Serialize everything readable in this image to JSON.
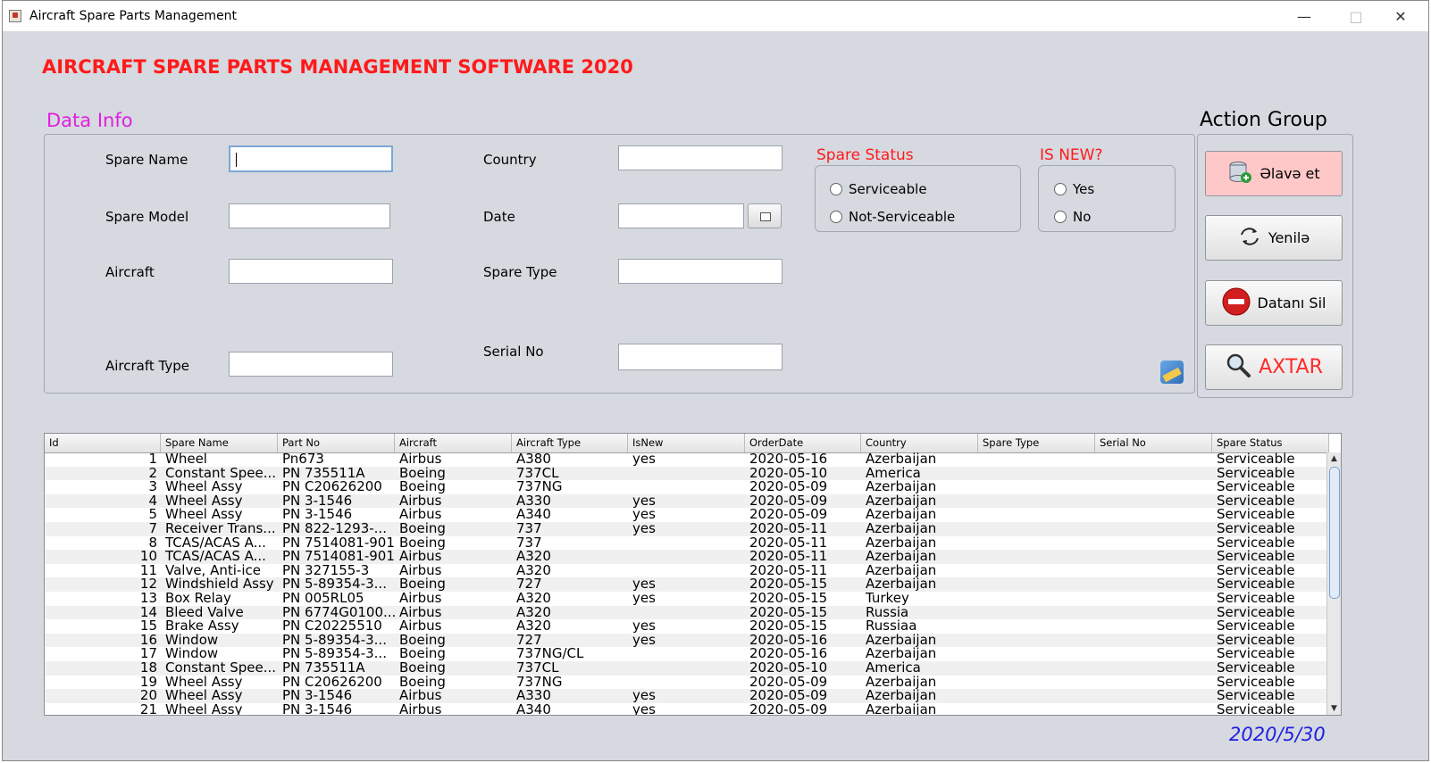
{
  "window": {
    "title": "Aircraft Spare Parts Management"
  },
  "heading": "AIRCRAFT SPARE PARTS MANAGEMENT SOFTWARE 2020",
  "data_info": {
    "label": "Data Info",
    "spare_name_label": "Spare Name",
    "spare_model_label": "Spare Model",
    "aircraft_label": "Aircraft",
    "aircraft_type_label": "Aircraft Type",
    "country_label": "Country",
    "date_label": "Date",
    "spare_type_label": "Spare Type",
    "serial_no_label": "Serial No",
    "spare_status_title": "Spare Status",
    "serviceable_label": "Serviceable",
    "not_serviceable_label": "Not-Serviceable",
    "is_new_title": "IS NEW?",
    "yes_label": "Yes",
    "no_label": "No"
  },
  "actions": {
    "title": "Action Group",
    "add_label": "Əlavə et",
    "refresh_label": "Yenilə",
    "delete_label": "Datanı Sil",
    "search_label": "AXTAR"
  },
  "table": {
    "columns": [
      "Id",
      "Spare Name",
      "Part No",
      "Aircraft",
      "Aircraft Type",
      "IsNew",
      "OrderDate",
      "Country",
      "Spare Type",
      "Serial No",
      "Spare Status"
    ],
    "rows": [
      [
        "1",
        "Wheel",
        "Pn673",
        "Airbus",
        "A380",
        "yes",
        "2020-05-16",
        "Azerbaijan",
        "",
        "",
        "Serviceable"
      ],
      [
        "2",
        "Constant Spee...",
        "PN 735511A",
        "Boeing",
        "737CL",
        "",
        "2020-05-10",
        "America",
        "",
        "",
        "Serviceable"
      ],
      [
        "3",
        "Wheel Assy",
        "PN C20626200",
        "Boeing",
        "737NG",
        "",
        "2020-05-09",
        "Azerbaijan",
        "",
        "",
        "Serviceable"
      ],
      [
        "4",
        "Wheel Assy",
        "PN 3-1546",
        "Airbus",
        "A330",
        "yes",
        "2020-05-09",
        "Azerbaijan",
        "",
        "",
        "Serviceable"
      ],
      [
        "5",
        "Wheel Assy",
        "PN 3-1546",
        "Airbus",
        "A340",
        "yes",
        "2020-05-09",
        "Azerbaijan",
        "",
        "",
        "Serviceable"
      ],
      [
        "7",
        "Receiver Trans...",
        "PN 822-1293-...",
        "Boeing",
        "737",
        "yes",
        "2020-05-11",
        "Azerbaijan",
        "",
        "",
        "Serviceable"
      ],
      [
        "8",
        "TCAS/ACAS A...",
        "PN 7514081-901",
        "Boeing",
        "737",
        "",
        "2020-05-11",
        "Azerbaijan",
        "",
        "",
        "Serviceable"
      ],
      [
        "10",
        "TCAS/ACAS A...",
        "PN 7514081-901",
        "Airbus",
        "A320",
        "",
        "2020-05-11",
        "Azerbaijan",
        "",
        "",
        "Serviceable"
      ],
      [
        "11",
        "Valve, Anti-ice",
        "PN 327155-3",
        "Airbus",
        "A320",
        "",
        "2020-05-11",
        "Azerbaijan",
        "",
        "",
        "Serviceable"
      ],
      [
        "12",
        "Windshield Assy",
        "PN 5-89354-3...",
        "Boeing",
        "727",
        "yes",
        "2020-05-15",
        "Azerbaijan",
        "",
        "",
        "Serviceable"
      ],
      [
        "13",
        "Box Relay",
        "PN 005RL05",
        "Airbus",
        "A320",
        "yes",
        "2020-05-15",
        "Turkey",
        "",
        "",
        "Serviceable"
      ],
      [
        "14",
        "Bleed Valve",
        "PN 6774G0100...",
        "Airbus",
        "A320",
        "",
        "2020-05-15",
        "Russia",
        "",
        "",
        "Serviceable"
      ],
      [
        "15",
        "Brake Assy",
        "PN C20225510",
        "Airbus",
        "A320",
        "yes",
        "2020-05-15",
        "Russiaa",
        "",
        "",
        "Serviceable"
      ],
      [
        "16",
        "Window",
        "PN 5-89354-3...",
        "Boeing",
        "727",
        "yes",
        "2020-05-16",
        "Azerbaijan",
        "",
        "",
        "Serviceable"
      ],
      [
        "17",
        "Window",
        "PN 5-89354-3...",
        "Boeing",
        "737NG/CL",
        "",
        "2020-05-16",
        "Azerbaijan",
        "",
        "",
        "Serviceable"
      ],
      [
        "18",
        "Constant Spee...",
        "PN 735511A",
        "Boeing",
        "737CL",
        "",
        "2020-05-10",
        "America",
        "",
        "",
        "Serviceable"
      ],
      [
        "19",
        "Wheel Assy",
        "PN C20626200",
        "Boeing",
        "737NG",
        "",
        "2020-05-09",
        "Azerbaijan",
        "",
        "",
        "Serviceable"
      ],
      [
        "20",
        "Wheel Assy",
        "PN 3-1546",
        "Airbus",
        "A330",
        "yes",
        "2020-05-09",
        "Azerbaijan",
        "",
        "",
        "Serviceable"
      ],
      [
        "21",
        "Wheel Assy",
        "PN 3-1546",
        "Airbus",
        "A340",
        "yes",
        "2020-05-09",
        "Azerbaijan",
        "",
        "",
        "Serviceable"
      ]
    ]
  },
  "footer_date": "2020/5/30"
}
